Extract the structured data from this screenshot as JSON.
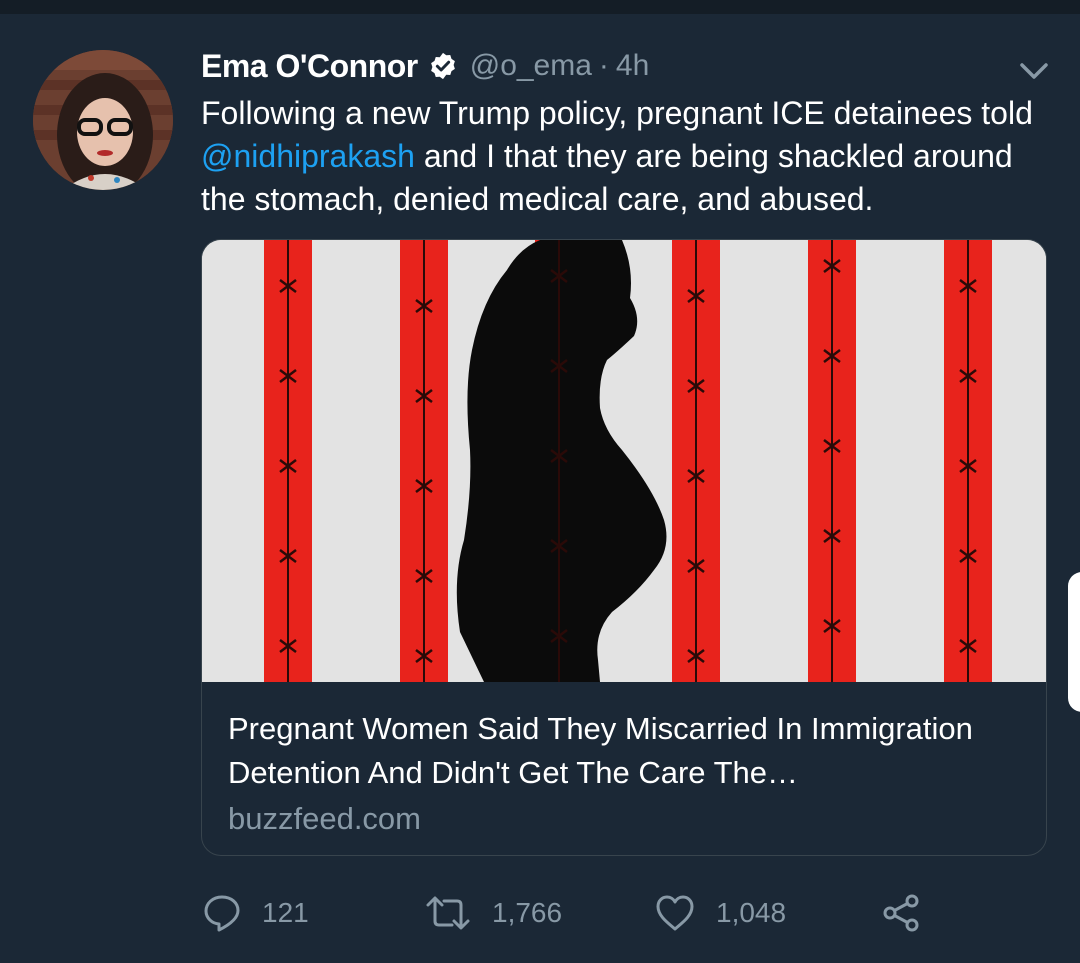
{
  "tweet": {
    "author_name": "Ema O'Connor",
    "handle": "@o_ema",
    "separator": "·",
    "time": "4h",
    "text_before": "Following a new Trump policy, pregnant ICE detainees told ",
    "mention": "@nidhiprakash",
    "text_after": " and I that they are being shackled around the stomach, denied medical care, and abused."
  },
  "card": {
    "title": "Pregnant Women Said They Miscarried In Immigration Detention And Didn't Get The Care The…",
    "domain": "buzzfeed.com"
  },
  "actions": {
    "replies": "121",
    "retweets": "1,766",
    "likes": "1,048"
  },
  "icons": [
    "verified-badge-icon",
    "chevron-down-icon",
    "reply-icon",
    "retweet-icon",
    "like-icon",
    "share-icon"
  ],
  "colors": {
    "background": "#1b2836",
    "text": "#ffffff",
    "secondary": "#8899a6",
    "link": "#1da1f2",
    "card_border": "#38444d",
    "image_red": "#e8231c"
  }
}
